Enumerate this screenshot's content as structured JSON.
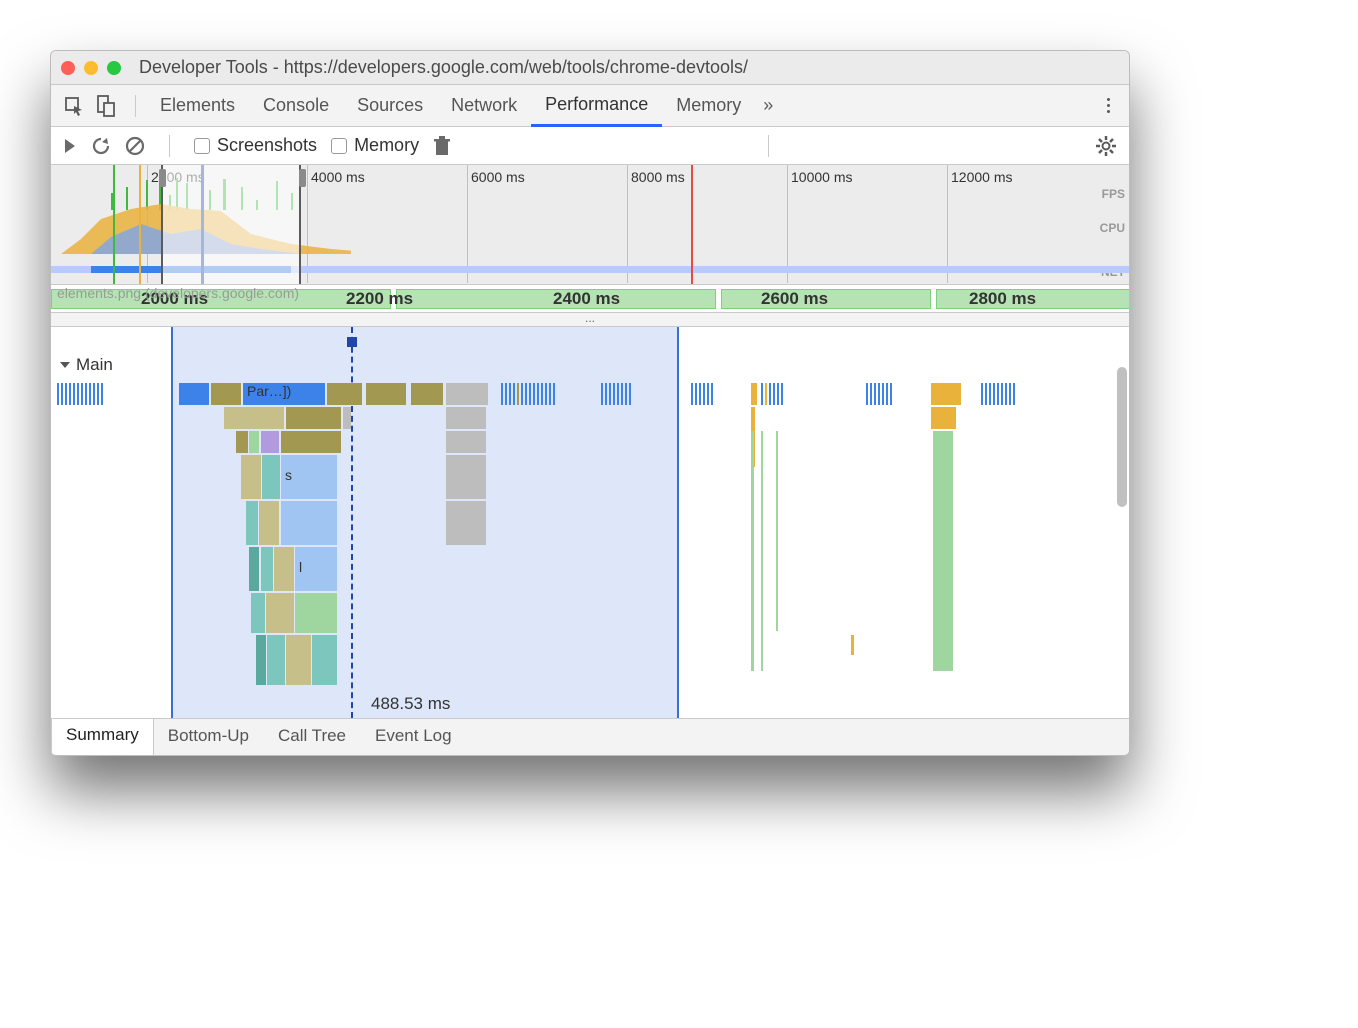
{
  "window": {
    "title": "Developer Tools - https://developers.google.com/web/tools/chrome-devtools/"
  },
  "tabs": {
    "items": [
      "Elements",
      "Console",
      "Sources",
      "Network",
      "Performance",
      "Memory"
    ],
    "active_index": 4
  },
  "toolbar": {
    "screenshots_label": "Screenshots",
    "memory_label": "Memory"
  },
  "overview": {
    "ticks": [
      "2000 ms",
      "4000 ms",
      "6000 ms",
      "8000 ms",
      "10000 ms",
      "12000 ms"
    ],
    "labels": [
      "FPS",
      "CPU",
      "NET"
    ]
  },
  "ruler": {
    "dim_text": "elements.png (developers.google.com)",
    "ticks": [
      "2000 ms",
      "2200 ms",
      "2400 ms",
      "2600 ms",
      "2800 ms"
    ],
    "ellipsis": "..."
  },
  "flame": {
    "main_label": "Main",
    "selection_time": "488.53 ms",
    "task_labels": {
      "parse": "Par…])",
      "s": "s",
      "l": "l"
    }
  },
  "bottom_tabs": {
    "items": [
      "Summary",
      "Bottom-Up",
      "Call Tree",
      "Event Log"
    ],
    "active_index": 0
  }
}
